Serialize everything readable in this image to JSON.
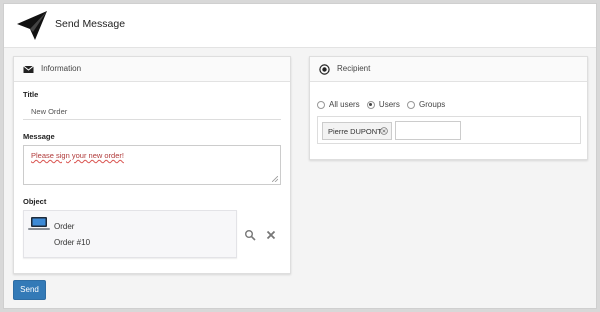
{
  "header": {
    "title": "Send Message",
    "icon": "paper-plane-icon"
  },
  "information": {
    "heading": "Information",
    "icon": "envelope-icon",
    "title_label": "Title",
    "title_value": "New Order",
    "message_label": "Message",
    "message_value": "Please sign your new order!",
    "object_label": "Object",
    "object": {
      "icon": "laptop-icon",
      "type": "Order",
      "name": "Order #10"
    }
  },
  "recipient": {
    "heading": "Recipient",
    "icon": "target-icon",
    "options": [
      "All users",
      "Users",
      "Groups"
    ],
    "selected": "Users",
    "tags": [
      {
        "label": "Pierre DUPONT"
      }
    ]
  },
  "actions": {
    "send_label": "Send"
  },
  "colors": {
    "primary": "#337ab7",
    "accent_text": "#b03a3a"
  }
}
